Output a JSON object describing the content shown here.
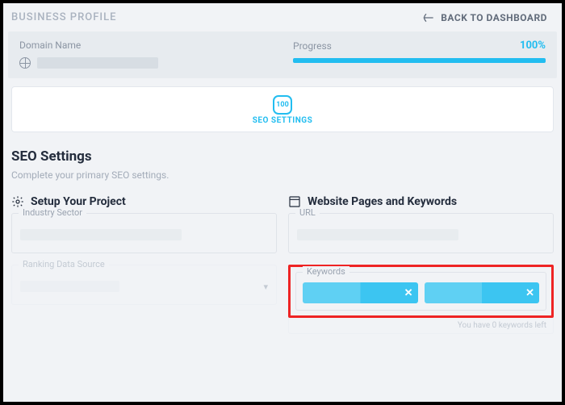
{
  "topbar": {
    "title": "BUSINESS PROFILE",
    "back_label": "BACK TO DASHBOARD"
  },
  "progress": {
    "domain_label": "Domain Name",
    "progress_label": "Progress",
    "percent": "100%"
  },
  "tab": {
    "badge": "100",
    "label": "SEO SETTINGS"
  },
  "section": {
    "title": "SEO Settings",
    "subtitle": "Complete your primary SEO settings."
  },
  "left": {
    "heading": "Setup Your Project",
    "industry_label": "Industry Sector",
    "ranking_label": "Ranking Data Source"
  },
  "right": {
    "heading": "Website Pages and Keywords",
    "url_label": "URL",
    "keywords_label": "Keywords",
    "keywords_hint": "You have 0 keywords left"
  }
}
